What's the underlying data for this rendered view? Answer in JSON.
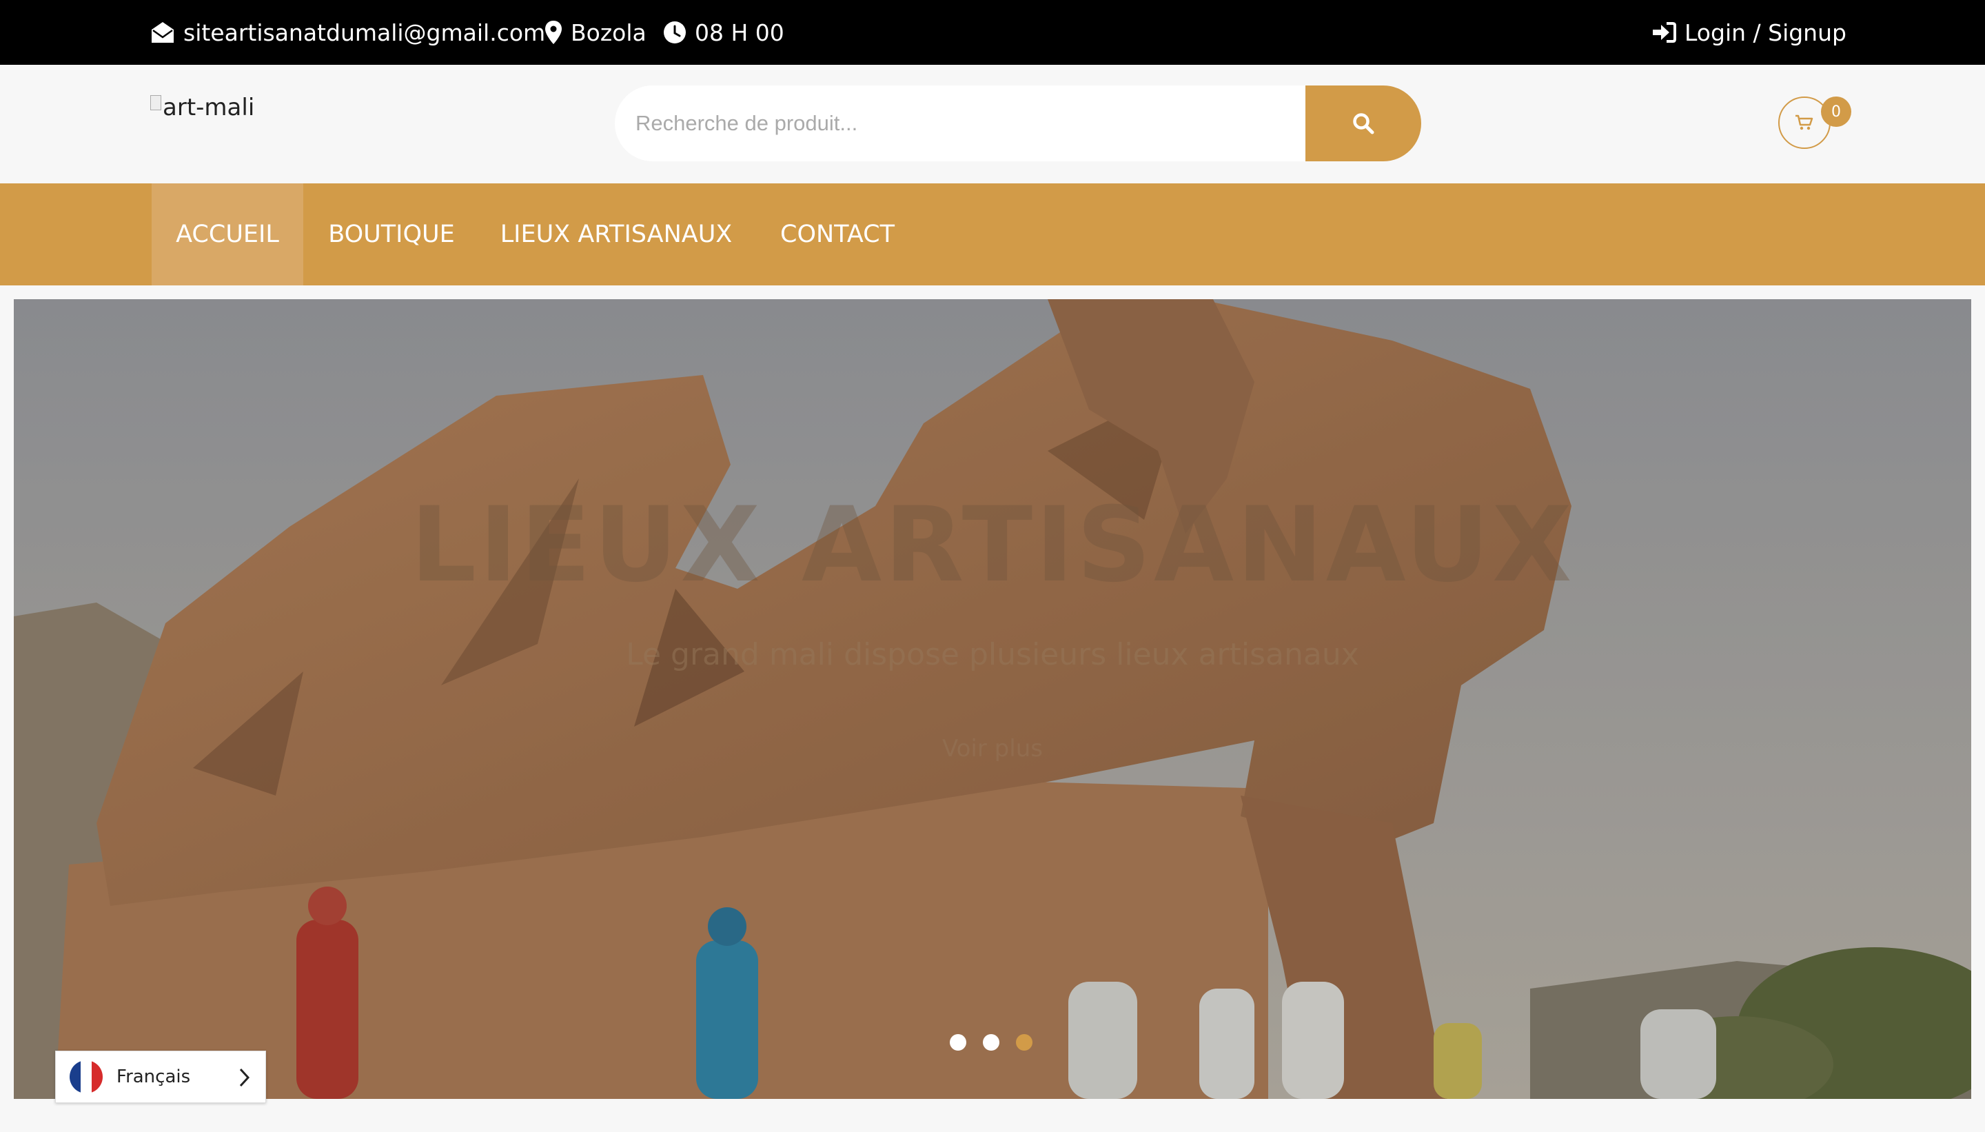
{
  "topbar": {
    "email": "siteartisanatdumali@gmail.com",
    "location": "Bozola",
    "hours": "08 H 00",
    "login_label": "Login / Signup"
  },
  "header": {
    "logo_alt": "art-mali",
    "search_placeholder": "Recherche de produit...",
    "cart_count": "0"
  },
  "nav": {
    "items": [
      {
        "label": "ACCUEIL",
        "active": true
      },
      {
        "label": "BOUTIQUE",
        "active": false
      },
      {
        "label": "LIEUX ARTISANAUX",
        "active": false
      },
      {
        "label": "CONTACT",
        "active": false
      }
    ]
  },
  "hero": {
    "title": "LIEUX ARTISANAUX",
    "subtitle": "Le grand mali dispose plusieurs lieux artisanaux",
    "cta": "Voir plus",
    "slides": 3,
    "active_slide": 3
  },
  "language": {
    "label": "Français"
  },
  "colors": {
    "accent": "#d29b48",
    "topbar": "#000000"
  },
  "icons": {
    "email": "envelope-open-icon",
    "location": "map-marker-icon",
    "hours": "clock-icon",
    "login": "sign-in-icon",
    "search": "search-icon",
    "cart": "shopping-cart-icon"
  }
}
